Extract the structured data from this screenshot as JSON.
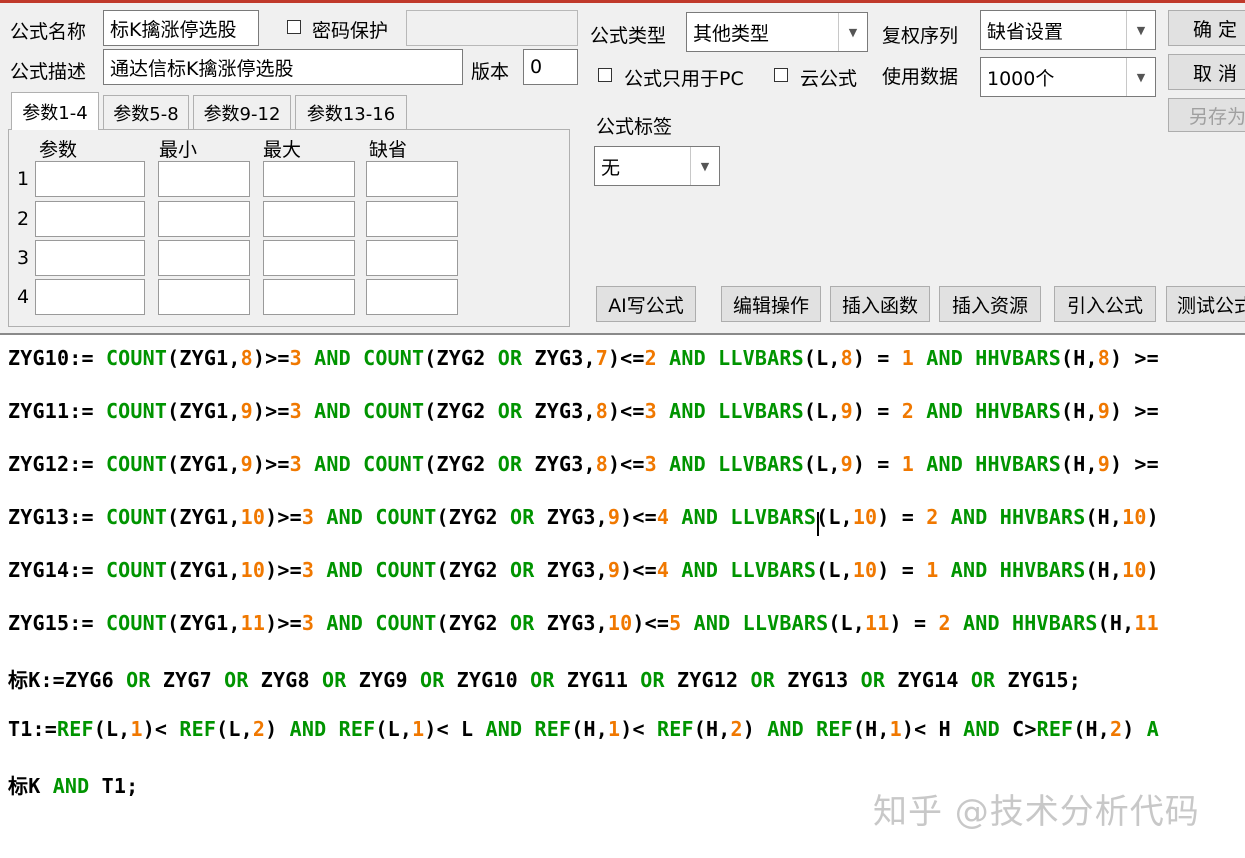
{
  "form": {
    "name_label": "公式名称",
    "name_value": "标K擒涨停选股",
    "password_label": "密码保护",
    "desc_label": "公式描述",
    "desc_value": "通达信标K擒涨停选股",
    "version_label": "版本",
    "version_value": "0",
    "type_label": "公式类型",
    "type_value": "其他类型",
    "rights_label": "复权序列",
    "rights_value": "缺省设置",
    "pc_only_label": "公式只用于PC",
    "cloud_label": "云公式",
    "data_label": "使用数据",
    "data_value": "1000个",
    "tag_label": "公式标签",
    "tag_value": "无"
  },
  "buttons": {
    "ok": "确 定",
    "cancel": "取 消",
    "save_as": "另存为",
    "ai": "AI写公式",
    "edit": "编辑操作",
    "insert_func": "插入函数",
    "insert_res": "插入资源",
    "import": "引入公式",
    "test": "测试公式"
  },
  "tabs": [
    "参数1-4",
    "参数5-8",
    "参数9-12",
    "参数13-16"
  ],
  "params": {
    "headers": [
      "参数",
      "最小",
      "最大",
      "缺省"
    ],
    "rows": [
      "1",
      "2",
      "3",
      "4"
    ]
  },
  "code": [
    [
      [
        "ZYG10:= ",
        ""
      ],
      [
        "COUNT",
        "k"
      ],
      [
        "(ZYG1,",
        ""
      ],
      [
        "8",
        "n"
      ],
      [
        ")>=",
        ""
      ],
      [
        "3",
        "n"
      ],
      [
        " ",
        ""
      ],
      [
        "AND",
        "k"
      ],
      [
        " ",
        ""
      ],
      [
        "COUNT",
        "k"
      ],
      [
        "(ZYG2 ",
        ""
      ],
      [
        "OR",
        "k"
      ],
      [
        " ZYG3,",
        ""
      ],
      [
        "7",
        "n"
      ],
      [
        ")<=",
        ""
      ],
      [
        "2",
        "n"
      ],
      [
        " ",
        ""
      ],
      [
        "AND",
        "k"
      ],
      [
        " ",
        ""
      ],
      [
        "LLVBARS",
        "k"
      ],
      [
        "(L,",
        ""
      ],
      [
        "8",
        "n"
      ],
      [
        ") = ",
        ""
      ],
      [
        "1",
        "n"
      ],
      [
        " ",
        ""
      ],
      [
        "AND",
        "k"
      ],
      [
        " ",
        ""
      ],
      [
        "HHVBARS",
        "k"
      ],
      [
        "(H,",
        ""
      ],
      [
        "8",
        "n"
      ],
      [
        ") >=",
        ""
      ]
    ],
    [
      [
        "ZYG11:= ",
        ""
      ],
      [
        "COUNT",
        "k"
      ],
      [
        "(ZYG1,",
        ""
      ],
      [
        "9",
        "n"
      ],
      [
        ")>=",
        ""
      ],
      [
        "3",
        "n"
      ],
      [
        " ",
        ""
      ],
      [
        "AND",
        "k"
      ],
      [
        " ",
        ""
      ],
      [
        "COUNT",
        "k"
      ],
      [
        "(ZYG2 ",
        ""
      ],
      [
        "OR",
        "k"
      ],
      [
        " ZYG3,",
        ""
      ],
      [
        "8",
        "n"
      ],
      [
        ")<=",
        ""
      ],
      [
        "3",
        "n"
      ],
      [
        " ",
        ""
      ],
      [
        "AND",
        "k"
      ],
      [
        " ",
        ""
      ],
      [
        "LLVBARS",
        "k"
      ],
      [
        "(L,",
        ""
      ],
      [
        "9",
        "n"
      ],
      [
        ") = ",
        ""
      ],
      [
        "2",
        "n"
      ],
      [
        " ",
        ""
      ],
      [
        "AND",
        "k"
      ],
      [
        " ",
        ""
      ],
      [
        "HHVBARS",
        "k"
      ],
      [
        "(H,",
        ""
      ],
      [
        "9",
        "n"
      ],
      [
        ") >=",
        ""
      ]
    ],
    [
      [
        "ZYG12:= ",
        ""
      ],
      [
        "COUNT",
        "k"
      ],
      [
        "(ZYG1,",
        ""
      ],
      [
        "9",
        "n"
      ],
      [
        ")>=",
        ""
      ],
      [
        "3",
        "n"
      ],
      [
        " ",
        ""
      ],
      [
        "AND",
        "k"
      ],
      [
        " ",
        ""
      ],
      [
        "COUNT",
        "k"
      ],
      [
        "(ZYG2 ",
        ""
      ],
      [
        "OR",
        "k"
      ],
      [
        " ZYG3,",
        ""
      ],
      [
        "8",
        "n"
      ],
      [
        ")<=",
        ""
      ],
      [
        "3",
        "n"
      ],
      [
        " ",
        ""
      ],
      [
        "AND",
        "k"
      ],
      [
        " ",
        ""
      ],
      [
        "LLVBARS",
        "k"
      ],
      [
        "(L,",
        ""
      ],
      [
        "9",
        "n"
      ],
      [
        ") = ",
        ""
      ],
      [
        "1",
        "n"
      ],
      [
        " ",
        ""
      ],
      [
        "AND",
        "k"
      ],
      [
        " ",
        ""
      ],
      [
        "HHVBARS",
        "k"
      ],
      [
        "(H,",
        ""
      ],
      [
        "9",
        "n"
      ],
      [
        ") >=",
        ""
      ]
    ],
    [
      [
        "ZYG13:= ",
        ""
      ],
      [
        "COUNT",
        "k"
      ],
      [
        "(ZYG1,",
        ""
      ],
      [
        "10",
        "n"
      ],
      [
        ")>=",
        ""
      ],
      [
        "3",
        "n"
      ],
      [
        " ",
        ""
      ],
      [
        "AND",
        "k"
      ],
      [
        " ",
        ""
      ],
      [
        "COUNT",
        "k"
      ],
      [
        "(ZYG2 ",
        ""
      ],
      [
        "OR",
        "k"
      ],
      [
        " ZYG3,",
        ""
      ],
      [
        "9",
        "n"
      ],
      [
        ")<=",
        ""
      ],
      [
        "4",
        "n"
      ],
      [
        " ",
        ""
      ],
      [
        "AND",
        "k"
      ],
      [
        " ",
        ""
      ],
      [
        "LLVBARS",
        "k"
      ],
      [
        "(L,",
        ""
      ],
      [
        "10",
        "n"
      ],
      [
        ") = ",
        ""
      ],
      [
        "2",
        "n"
      ],
      [
        " ",
        ""
      ],
      [
        "AND",
        "k"
      ],
      [
        " ",
        ""
      ],
      [
        "HHVBARS",
        "k"
      ],
      [
        "(H,",
        ""
      ],
      [
        "10",
        "n"
      ],
      [
        ")",
        ""
      ]
    ],
    [
      [
        "ZYG14:= ",
        ""
      ],
      [
        "COUNT",
        "k"
      ],
      [
        "(ZYG1,",
        ""
      ],
      [
        "10",
        "n"
      ],
      [
        ")>=",
        ""
      ],
      [
        "3",
        "n"
      ],
      [
        " ",
        ""
      ],
      [
        "AND",
        "k"
      ],
      [
        " ",
        ""
      ],
      [
        "COUNT",
        "k"
      ],
      [
        "(ZYG2 ",
        ""
      ],
      [
        "OR",
        "k"
      ],
      [
        " ZYG3,",
        ""
      ],
      [
        "9",
        "n"
      ],
      [
        ")<=",
        ""
      ],
      [
        "4",
        "n"
      ],
      [
        " ",
        ""
      ],
      [
        "AND",
        "k"
      ],
      [
        " ",
        ""
      ],
      [
        "LLVBARS",
        "k"
      ],
      [
        "(L,",
        ""
      ],
      [
        "10",
        "n"
      ],
      [
        ") = ",
        ""
      ],
      [
        "1",
        "n"
      ],
      [
        " ",
        ""
      ],
      [
        "AND",
        "k"
      ],
      [
        " ",
        ""
      ],
      [
        "HHVBARS",
        "k"
      ],
      [
        "(H,",
        ""
      ],
      [
        "10",
        "n"
      ],
      [
        ")",
        ""
      ]
    ],
    [
      [
        "ZYG15:= ",
        ""
      ],
      [
        "COUNT",
        "k"
      ],
      [
        "(ZYG1,",
        ""
      ],
      [
        "11",
        "n"
      ],
      [
        ")>=",
        ""
      ],
      [
        "3",
        "n"
      ],
      [
        " ",
        ""
      ],
      [
        "AND",
        "k"
      ],
      [
        " ",
        ""
      ],
      [
        "COUNT",
        "k"
      ],
      [
        "(ZYG2 ",
        ""
      ],
      [
        "OR",
        "k"
      ],
      [
        " ZYG3,",
        ""
      ],
      [
        "10",
        "n"
      ],
      [
        ")<=",
        ""
      ],
      [
        "5",
        "n"
      ],
      [
        " ",
        ""
      ],
      [
        "AND",
        "k"
      ],
      [
        " ",
        ""
      ],
      [
        "LLVBARS",
        "k"
      ],
      [
        "(L,",
        ""
      ],
      [
        "11",
        "n"
      ],
      [
        ") = ",
        ""
      ],
      [
        "2",
        "n"
      ],
      [
        " ",
        ""
      ],
      [
        "AND",
        "k"
      ],
      [
        " ",
        ""
      ],
      [
        "HHVBARS",
        "k"
      ],
      [
        "(H,",
        ""
      ],
      [
        "11",
        "n"
      ]
    ],
    [
      [
        "标K:=ZYG6 ",
        ""
      ],
      [
        "OR",
        "k"
      ],
      [
        " ZYG7 ",
        ""
      ],
      [
        "OR",
        "k"
      ],
      [
        " ZYG8 ",
        ""
      ],
      [
        "OR",
        "k"
      ],
      [
        " ZYG9 ",
        ""
      ],
      [
        "OR",
        "k"
      ],
      [
        " ZYG10 ",
        ""
      ],
      [
        "OR",
        "k"
      ],
      [
        " ZYG11 ",
        ""
      ],
      [
        "OR",
        "k"
      ],
      [
        " ZYG12 ",
        ""
      ],
      [
        "OR",
        "k"
      ],
      [
        " ZYG13 ",
        ""
      ],
      [
        "OR",
        "k"
      ],
      [
        " ZYG14 ",
        ""
      ],
      [
        "OR",
        "k"
      ],
      [
        " ZYG15;",
        ""
      ]
    ],
    [
      [
        "T1:=",
        ""
      ],
      [
        "REF",
        "k"
      ],
      [
        "(L,",
        ""
      ],
      [
        "1",
        "n"
      ],
      [
        ")< ",
        ""
      ],
      [
        "REF",
        "k"
      ],
      [
        "(L,",
        ""
      ],
      [
        "2",
        "n"
      ],
      [
        ") ",
        ""
      ],
      [
        "AND",
        "k"
      ],
      [
        " ",
        ""
      ],
      [
        "REF",
        "k"
      ],
      [
        "(L,",
        ""
      ],
      [
        "1",
        "n"
      ],
      [
        ")< L ",
        ""
      ],
      [
        "AND",
        "k"
      ],
      [
        " ",
        ""
      ],
      [
        "REF",
        "k"
      ],
      [
        "(H,",
        ""
      ],
      [
        "1",
        "n"
      ],
      [
        ")< ",
        ""
      ],
      [
        "REF",
        "k"
      ],
      [
        "(H,",
        ""
      ],
      [
        "2",
        "n"
      ],
      [
        ") ",
        ""
      ],
      [
        "AND",
        "k"
      ],
      [
        " ",
        ""
      ],
      [
        "REF",
        "k"
      ],
      [
        "(H,",
        ""
      ],
      [
        "1",
        "n"
      ],
      [
        ")< H ",
        ""
      ],
      [
        "AND",
        "k"
      ],
      [
        " C>",
        ""
      ],
      [
        "REF",
        "k"
      ],
      [
        "(H,",
        ""
      ],
      [
        "2",
        "n"
      ],
      [
        ") ",
        ""
      ],
      [
        "A",
        "k"
      ]
    ],
    [
      [
        "标K ",
        ""
      ],
      [
        "AND",
        "k"
      ],
      [
        " T1;",
        ""
      ]
    ]
  ],
  "watermark": "知乎 @技术分析代码"
}
